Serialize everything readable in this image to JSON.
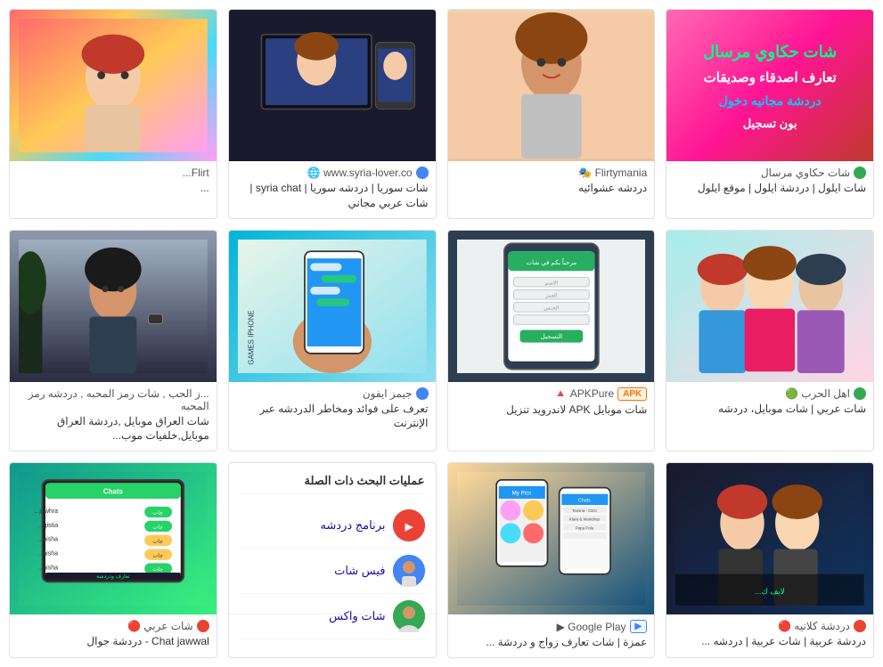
{
  "grid": {
    "rows": [
      {
        "cards": [
          {
            "id": "card-1-1",
            "image_type": "arabic-chat-banner",
            "image_bg": "#d63384",
            "source_icon": "green",
            "source_name": "شات حكاوي مرسال",
            "desc1": "شات ايلول | دردشة ايلول | موقع ايلول",
            "desc2": ""
          },
          {
            "id": "card-1-2",
            "image_type": "woman-portrait",
            "image_bg": "#f5cba7",
            "source_icon": "none",
            "source_name": "Flirtymania 🎭",
            "desc1": "دردشه عشوائيه",
            "desc2": ""
          },
          {
            "id": "card-1-3",
            "image_type": "video-chat",
            "image_bg": "#1a1a2e",
            "source_icon": "blue",
            "source_name": "www.syria-lover.co 🌐",
            "desc1": "شات سوريا | دردشه سوريا | syria chat | شات عربي مجاني",
            "desc2": ""
          },
          {
            "id": "card-1-4",
            "image_type": "colorful",
            "image_bg": "#ff6b6b",
            "source_icon": "none",
            "source_name": "Flirt...",
            "desc1": "...",
            "desc2": ""
          }
        ]
      },
      {
        "cards": [
          {
            "id": "card-2-1",
            "image_type": "girls-selfie",
            "image_bg": "#a8edea",
            "source_icon": "green",
            "source_name": "اهل الحرب 🟢",
            "desc1": "شات عربي | شات موبايل، دردشه",
            "desc2": ""
          },
          {
            "id": "card-2-2",
            "image_type": "app-form",
            "image_bg": "#2c3e50",
            "source_badge": "apk",
            "source_name": "APKPure 🔺",
            "desc1": "شات موبايل APK لاندرويد تنزيل",
            "desc2": ""
          },
          {
            "id": "card-2-3",
            "image_type": "phone-hand",
            "image_bg": "#00b4d8",
            "source_icon": "blue",
            "source_name": "جيمز ايفون",
            "desc1": "تعرف على فوائد ومخاطر الدردشه عبر الإنترنت",
            "desc2": ""
          },
          {
            "id": "card-2-4",
            "image_type": "dark-woman",
            "image_bg": "#8d99ae",
            "source_icon": "none",
            "source_name": "...ز الحب , شات رمز المحبه , دردشه رمز المحبه",
            "desc1": "شات العراق موبايل ,دردشة العراق موبايل,خلفيات موب...",
            "desc2": ""
          }
        ]
      },
      {
        "cards": [
          {
            "id": "card-3-1",
            "image_type": "dark-overlay",
            "image_bg": "#1a1a2e",
            "source_icon": "red",
            "source_name": "دردشة كلانيه 🔴",
            "desc1": "دردشة عربية | شات عربية | دردشه ...",
            "desc2": ""
          },
          {
            "id": "card-3-2",
            "image_type": "app-store",
            "image_bg": "#ffd89b",
            "source_badge": "google",
            "source_name": "Google Play ▶",
            "desc1": "عمزة | شات تعارف زواج و دردشة ...",
            "desc2": ""
          },
          {
            "id": "card-3-3",
            "image_type": "search-related",
            "image_bg": "#fff",
            "source_icon": "none",
            "source_name": "",
            "desc1": "",
            "desc2": "",
            "is_search_related": true,
            "search_title": "عمليات البحث ذات الصلة",
            "search_items": [
              {
                "label": "برنامج دردشه",
                "thumb_color": "red"
              },
              {
                "label": "فيس شات",
                "thumb_color": "blue"
              },
              {
                "label": "شات واكس",
                "thumb_color": "green"
              }
            ]
          },
          {
            "id": "card-3-4",
            "image_type": "tablet-chat",
            "image_bg": "#11998e",
            "source_icon": "red",
            "source_name": "شات عربي 🔴",
            "desc1": "Chat jawwal - دردشة جوال",
            "desc2": ""
          }
        ]
      }
    ]
  }
}
